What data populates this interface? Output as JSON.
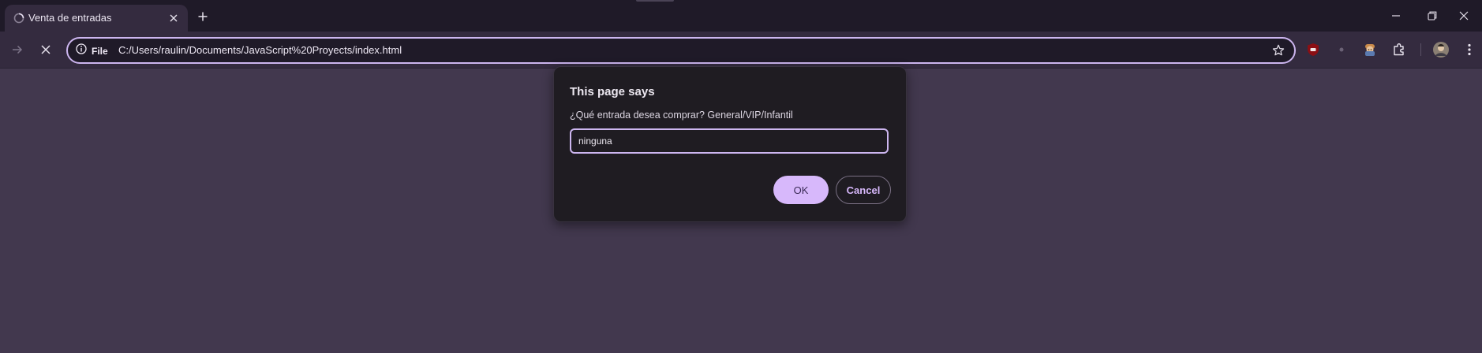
{
  "colors": {
    "tabstrip_bg": "#1f1a28",
    "toolbar_bg": "#342b3f",
    "page_bg": "#42384e",
    "accent": "#d7b8fb",
    "dialog_bg": "#1f1c22"
  },
  "tab": {
    "title": "Venta de entradas",
    "favicon": "spinner-icon"
  },
  "toolbar": {
    "site_label": "File",
    "url": "C:/Users/raulin/Documents/JavaScript%20Proyects/index.html"
  },
  "extensions": [
    "ublock-icon",
    "dot-icon",
    "character-icon",
    "puzzle-icon"
  ],
  "dialog": {
    "title": "This page says",
    "message": "¿Qué entrada desea comprar? General/VIP/Infantil",
    "input_value": "ninguna",
    "ok_label": "OK",
    "cancel_label": "Cancel"
  }
}
